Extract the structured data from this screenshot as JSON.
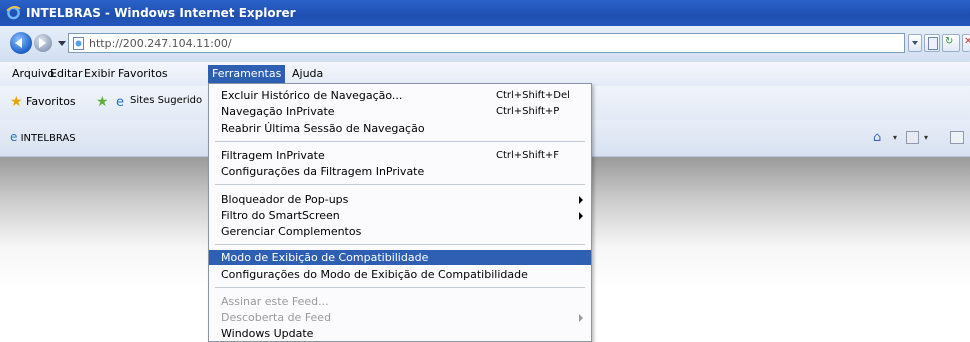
{
  "window": {
    "title": "INTELBRAS - Windows Internet Explorer"
  },
  "address_bar": {
    "value": "http://200.247.104.11:00/"
  },
  "menubar": {
    "items": [
      {
        "label": "Arquivo",
        "active": false
      },
      {
        "label": "Editar",
        "active": false
      },
      {
        "label": "Exibir",
        "active": false
      },
      {
        "label": "Favoritos",
        "active": false
      },
      {
        "label": "Ferramentas",
        "active": true
      },
      {
        "label": "Ajuda",
        "active": false
      }
    ]
  },
  "favorites_bar": {
    "favorites_label": "Favoritos",
    "suggested_label": "Sites Sugerido"
  },
  "tab": {
    "title": "INTELBRAS"
  },
  "tools_menu": {
    "items": [
      {
        "label": "Excluir Histórico de Navegação...",
        "shortcut": "Ctrl+Shift+Del",
        "submenu": false,
        "disabled": false,
        "highlighted": false
      },
      {
        "label": "Navegação InPrivate",
        "shortcut": "Ctrl+Shift+P",
        "submenu": false,
        "disabled": false,
        "highlighted": false
      },
      {
        "label": "Reabrir Última Sessão de Navegação",
        "shortcut": "",
        "submenu": false,
        "disabled": false,
        "highlighted": false
      },
      {
        "label": "Filtragem InPrivate",
        "shortcut": "Ctrl+Shift+F",
        "submenu": false,
        "disabled": false,
        "highlighted": false
      },
      {
        "label": "Configurações da Filtragem InPrivate",
        "shortcut": "",
        "submenu": false,
        "disabled": false,
        "highlighted": false
      },
      {
        "label": "Bloqueador de Pop-ups",
        "shortcut": "",
        "submenu": true,
        "disabled": false,
        "highlighted": false
      },
      {
        "label": "Filtro do SmartScreen",
        "shortcut": "",
        "submenu": true,
        "disabled": false,
        "highlighted": false
      },
      {
        "label": "Gerenciar Complementos",
        "shortcut": "",
        "submenu": false,
        "disabled": false,
        "highlighted": false
      },
      {
        "label": "Modo de Exibição de Compatibilidade",
        "shortcut": "",
        "submenu": false,
        "disabled": false,
        "highlighted": true
      },
      {
        "label": "Configurações do Modo de Exibição de Compatibilidade",
        "shortcut": "",
        "submenu": false,
        "disabled": false,
        "highlighted": false
      },
      {
        "label": "Assinar este Feed...",
        "shortcut": "",
        "submenu": false,
        "disabled": true,
        "highlighted": false
      },
      {
        "label": "Descoberta de Feed",
        "shortcut": "",
        "submenu": true,
        "disabled": true,
        "highlighted": false
      },
      {
        "label": "Windows Update",
        "shortcut": "",
        "submenu": false,
        "disabled": false,
        "highlighted": false
      }
    ]
  },
  "colors": {
    "titlebar": "#1f4fb0",
    "highlight": "#2f5fb3"
  }
}
